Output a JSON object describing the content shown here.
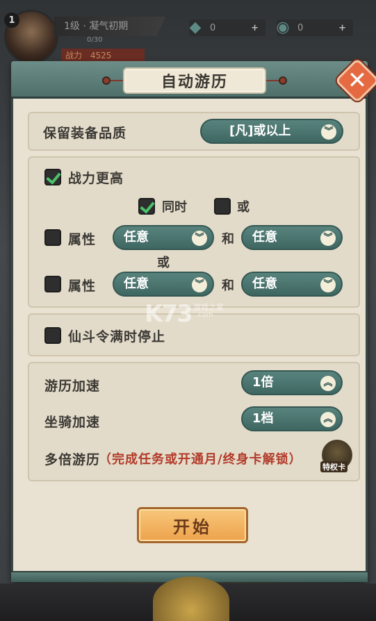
{
  "hud": {
    "level_badge": "1",
    "level_text": "1级 · 凝气初期",
    "exp_text": "0/30",
    "power_label": "战力",
    "power_value": "4525",
    "resource1": {
      "icon": "jade-diamond-icon",
      "value": "0",
      "plus": "+"
    },
    "resource2": {
      "icon": "spirit-coin-icon",
      "value": "0",
      "plus": "+"
    }
  },
  "dialog": {
    "title": "自动游历",
    "close_symbol": "✕",
    "equipment": {
      "label": "保留装备品质",
      "dropdown_value": "[凡]或以上"
    },
    "filters": {
      "higher_power": {
        "label": "战力更高",
        "checked": true
      },
      "logic_and": {
        "label": "同时",
        "checked": true
      },
      "logic_or": {
        "label": "或",
        "checked": false
      },
      "row1": {
        "label": "属性",
        "checked": false,
        "select_a": "任意",
        "joiner": "和",
        "select_b": "任意"
      },
      "between_rows": "或",
      "row2": {
        "label": "属性",
        "checked": false,
        "select_a": "任意",
        "joiner": "和",
        "select_b": "任意"
      }
    },
    "stop_when_full": {
      "label": "仙斗令满时停止",
      "checked": false
    },
    "speed": {
      "travel_label": "游历加速",
      "travel_value": "1倍",
      "mount_label": "坐骑加速",
      "mount_value": "1档",
      "multi_label": "多倍游历",
      "multi_unlock": "（完成任务或开通月/终身卡解锁）",
      "privilege_card": "特权卡"
    },
    "start_button": "开始"
  },
  "watermark": {
    "main": "K73",
    "sub": "游戏之家",
    "sub2": ".com"
  }
}
